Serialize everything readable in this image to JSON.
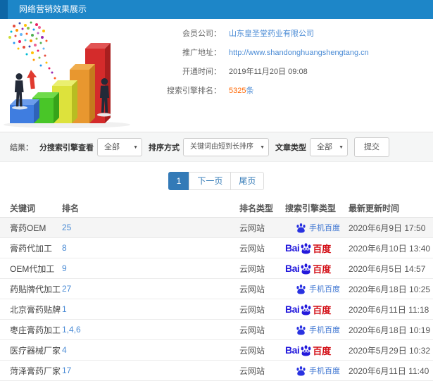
{
  "colors": {
    "accent": "#1d86c8",
    "accent_dark": "#0d66a6",
    "link": "#4a8bd5",
    "orange": "#ff6600",
    "pager": "#337ab7",
    "baidu_blue": "#2319dc",
    "baidu_red": "#d20b13",
    "mobile_blue": "#3f76d2"
  },
  "header": {
    "title": "网络营销效果展示"
  },
  "info": {
    "member_label": "会员公司：",
    "member_value": "山东皇圣堂药业有限公司",
    "url_label": "推广地址：",
    "url_value": "http://www.shandonghuangshengtang.cn",
    "open_label": "开通时间：",
    "open_value": "2019年11月20日 09:08",
    "rank_label": "搜索引擎排名：",
    "rank_count": "5325",
    "rank_unit": "条"
  },
  "filters": {
    "result_label": "结果：",
    "engine_label": "分搜索引擎查看",
    "engine_value": "全部",
    "sort_label": "排序方式",
    "sort_value": "关键词由短到长排序",
    "article_label": "文章类型",
    "article_value": "全部",
    "submit_label": "提交"
  },
  "pagination": {
    "current": "1",
    "next": "下一页",
    "last": "尾页"
  },
  "table": {
    "columns": [
      "关键词",
      "排名",
      "排名类型",
      "搜索引擎类型",
      "最新更新时间"
    ],
    "engine_labels": {
      "mobile": "手机百度",
      "baidu_latin": "Bai",
      "baidu_du": "du",
      "baidu_cn": "百度"
    },
    "rows": [
      {
        "keyword": "膏药OEM",
        "rank": "25",
        "rank_type": "云网站",
        "engine": "mobile-baidu",
        "updated": "2020年6月9日 17:50",
        "highlighted": true
      },
      {
        "keyword": "膏药代加工",
        "rank": "8",
        "rank_type": "云网站",
        "engine": "baidu",
        "updated": "2020年6月10日 13:40",
        "highlighted": false
      },
      {
        "keyword": "OEM代加工",
        "rank": "9",
        "rank_type": "云网站",
        "engine": "baidu",
        "updated": "2020年6月5日 14:57",
        "highlighted": false
      },
      {
        "keyword": "药贴牌代加工",
        "rank": "27",
        "rank_type": "云网站",
        "engine": "mobile-baidu",
        "updated": "2020年6月18日 10:25",
        "highlighted": false
      },
      {
        "keyword": "北京膏药贴牌",
        "rank": "1",
        "rank_type": "云网站",
        "engine": "baidu",
        "updated": "2020年6月11日 11:18",
        "highlighted": false
      },
      {
        "keyword": "枣庄膏药加工",
        "rank": "1,4,6",
        "rank_type": "云网站",
        "engine": "mobile-baidu",
        "updated": "2020年6月18日 10:19",
        "highlighted": false
      },
      {
        "keyword": "医疗器械厂家",
        "rank": "4",
        "rank_type": "云网站",
        "engine": "baidu",
        "updated": "2020年5月29日 10:32",
        "highlighted": false
      },
      {
        "keyword": "菏泽膏药厂家",
        "rank": "17",
        "rank_type": "云网站",
        "engine": "mobile-baidu",
        "updated": "2020年6月11日 11:40",
        "highlighted": false
      }
    ]
  }
}
